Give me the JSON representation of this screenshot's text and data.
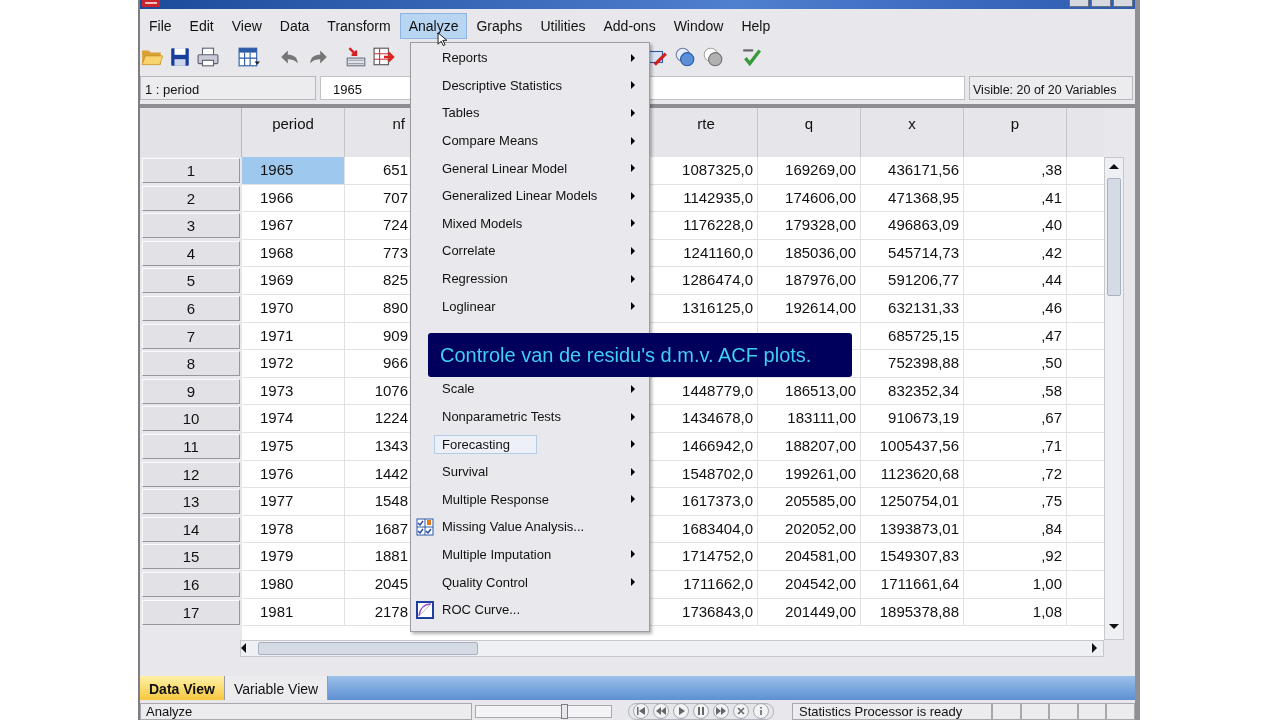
{
  "menu_bar": [
    {
      "label": "File",
      "selected": false
    },
    {
      "label": "Edit",
      "selected": false
    },
    {
      "label": "View",
      "selected": false
    },
    {
      "label": "Data",
      "selected": false
    },
    {
      "label": "Transform",
      "selected": false
    },
    {
      "label": "Analyze",
      "selected": true
    },
    {
      "label": "Graphs",
      "selected": false
    },
    {
      "label": "Utilities",
      "selected": false
    },
    {
      "label": "Add-ons",
      "selected": false
    },
    {
      "label": "Window",
      "selected": false
    },
    {
      "label": "Help",
      "selected": false
    }
  ],
  "toolbar": [
    {
      "kind": "open",
      "disabled": false
    },
    {
      "kind": "save",
      "disabled": false
    },
    {
      "kind": "print",
      "disabled": false
    },
    {
      "kind": "dialog",
      "disabled": false
    },
    {
      "kind": "undo",
      "disabled": true
    },
    {
      "kind": "redo",
      "disabled": true
    },
    {
      "kind": "goto",
      "disabled": false
    },
    {
      "kind": "insert",
      "disabled": false
    },
    {
      "kind": "tag",
      "disabled": false
    },
    {
      "kind": "sets",
      "disabled": false
    },
    {
      "kind": "sets",
      "disabled": true
    },
    {
      "kind": "spell",
      "disabled": false
    }
  ],
  "cell_editor": {
    "cell": "1 : period",
    "value": "1965",
    "visible": "Visible: 20 of 20 Variables"
  },
  "table": {
    "columns": [
      {
        "label": "period",
        "kind": "text",
        "selected": true
      },
      {
        "label": "nf",
        "kind": "clipped",
        "selected": false
      },
      {
        "label": "rte",
        "kind": "number",
        "selected": false
      },
      {
        "label": "q",
        "kind": "number",
        "selected": false
      },
      {
        "label": "x",
        "kind": "number",
        "selected": false
      },
      {
        "label": "p",
        "kind": "number",
        "selected": false
      }
    ],
    "rows": [
      {
        "number": "1",
        "selected": true,
        "cells": [
          "1965",
          "651",
          "1087325,0",
          "169269,00",
          "436171,56",
          ",38"
        ]
      },
      {
        "number": "2",
        "selected": false,
        "cells": [
          "1966",
          "707",
          "1142935,0",
          "174606,00",
          "471368,95",
          ",41"
        ]
      },
      {
        "number": "3",
        "selected": false,
        "cells": [
          "1967",
          "724",
          "1176228,0",
          "179328,00",
          "496863,09",
          ",40"
        ]
      },
      {
        "number": "4",
        "selected": false,
        "cells": [
          "1968",
          "773",
          "1241160,0",
          "185036,00",
          "545714,73",
          ",42"
        ]
      },
      {
        "number": "5",
        "selected": false,
        "cells": [
          "1969",
          "825",
          "1286474,0",
          "187976,00",
          "591206,77",
          ",44"
        ]
      },
      {
        "number": "6",
        "selected": false,
        "cells": [
          "1970",
          "890",
          "1316125,0",
          "192614,00",
          "632131,33",
          ",46"
        ]
      },
      {
        "number": "7",
        "selected": false,
        "cells": [
          "1971",
          "909",
          null,
          null,
          "685725,15",
          ",47"
        ]
      },
      {
        "number": "8",
        "selected": false,
        "cells": [
          "1972",
          "966",
          null,
          null,
          "752398,88",
          ",50"
        ]
      },
      {
        "number": "9",
        "selected": false,
        "cells": [
          "1973",
          "1076",
          "1448779,0",
          "186513,00",
          "832352,34",
          ",58"
        ]
      },
      {
        "number": "10",
        "selected": false,
        "cells": [
          "1974",
          "1224",
          "1434678,0",
          "183111,00",
          "910673,19",
          ",67"
        ]
      },
      {
        "number": "11",
        "selected": false,
        "cells": [
          "1975",
          "1343",
          "1466942,0",
          "188207,00",
          "1005437,56",
          ",71"
        ]
      },
      {
        "number": "12",
        "selected": false,
        "cells": [
          "1976",
          "1442",
          "1548702,0",
          "199261,00",
          "1123620,68",
          ",72"
        ]
      },
      {
        "number": "13",
        "selected": false,
        "cells": [
          "1977",
          "1548",
          "1617373,0",
          "205585,00",
          "1250754,01",
          ",75"
        ]
      },
      {
        "number": "14",
        "selected": false,
        "cells": [
          "1978",
          "1687",
          "1683404,0",
          "202052,00",
          "1393873,01",
          ",84"
        ]
      },
      {
        "number": "15",
        "selected": false,
        "cells": [
          "1979",
          "1881",
          "1714752,0",
          "204581,00",
          "1549307,83",
          ",92"
        ]
      },
      {
        "number": "16",
        "selected": false,
        "cells": [
          "1980",
          "2045",
          "1711662,0",
          "204542,00",
          "1711661,64",
          "1,00"
        ]
      },
      {
        "number": "17",
        "selected": false,
        "cells": [
          "1981",
          "2178",
          "1736843,0",
          "201449,00",
          "1895378,88",
          "1,08"
        ]
      }
    ]
  },
  "analyze_menu": {
    "items": [
      {
        "label": "Reports",
        "kind": "submenu",
        "selected": false
      },
      {
        "label": "Descriptive Statistics",
        "kind": "submenu",
        "selected": false
      },
      {
        "label": "Tables",
        "kind": "submenu",
        "selected": false
      },
      {
        "label": "Compare Means",
        "kind": "submenu",
        "selected": false
      },
      {
        "label": "General Linear Model",
        "kind": "submenu",
        "selected": false
      },
      {
        "label": "Generalized Linear Models",
        "kind": "submenu",
        "selected": false
      },
      {
        "label": "Mixed Models",
        "kind": "submenu",
        "selected": false
      },
      {
        "label": "Correlate",
        "kind": "submenu",
        "selected": false
      },
      {
        "label": "Regression",
        "kind": "submenu",
        "selected": false
      },
      {
        "label": "Loglinear",
        "kind": "submenu",
        "selected": false
      },
      {
        "kind": "covered"
      },
      {
        "kind": "covered"
      },
      {
        "label": "Scale",
        "kind": "submenu",
        "selected": false
      },
      {
        "label": "Nonparametric Tests",
        "kind": "submenu",
        "selected": false
      },
      {
        "label": "Forecasting",
        "kind": "submenu",
        "selected": true
      },
      {
        "label": "Survival",
        "kind": "submenu",
        "selected": false
      },
      {
        "label": "Multiple Response",
        "kind": "submenu",
        "selected": false
      },
      {
        "label": "Missing Value Analysis...",
        "kind": "checks",
        "selected": false
      },
      {
        "label": "Multiple Imputation",
        "kind": "submenu",
        "selected": false
      },
      {
        "label": "Quality Control",
        "kind": "submenu",
        "selected": false
      },
      {
        "label": "ROC Curve...",
        "kind": "curve",
        "selected": false
      }
    ]
  },
  "caption": {
    "text": "Controle van de residu's d.m.v. ACF plots."
  },
  "view_tabs": [
    {
      "label": "Data View",
      "selected": true
    },
    {
      "label": "Variable View",
      "selected": false
    }
  ],
  "status_bar": {
    "message": "Analyze",
    "slider": {
      "level": 0.65
    },
    "status": "Statistics Processor is ready"
  }
}
